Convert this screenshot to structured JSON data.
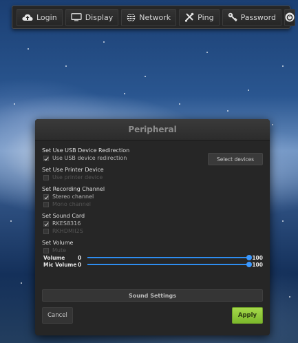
{
  "toolbar": {
    "items": [
      {
        "label": "Login",
        "icon": "cloud-upload-icon"
      },
      {
        "label": "Display",
        "icon": "monitor-icon"
      },
      {
        "label": "Network",
        "icon": "globe-icon"
      },
      {
        "label": "Ping",
        "icon": "tools-icon"
      },
      {
        "label": "Password",
        "icon": "key-icon"
      }
    ],
    "power_icon": "power-icon"
  },
  "dialog": {
    "title": "Peripheral",
    "usb": {
      "title": "Set Use USB Device Redirection",
      "option": "Use USB device redirection",
      "checked": true,
      "select_button": "Select devices"
    },
    "printer": {
      "title": "Set Use Printer Device",
      "option": "Use printer device",
      "checked": false
    },
    "recording": {
      "title": "Set Recording Channel",
      "options": [
        {
          "label": "Stereo channel",
          "checked": true
        },
        {
          "label": "Mono channel",
          "checked": false
        }
      ]
    },
    "sound_card": {
      "title": "Set Sound Card",
      "options": [
        {
          "label": "RKES8316",
          "checked": true
        },
        {
          "label": "RKHDMII2S",
          "checked": false
        }
      ]
    },
    "volume": {
      "title": "Set Volume",
      "mute_label": "Mute",
      "mute_checked": false,
      "volume_label": "Volume",
      "volume_min": "0",
      "volume_max": "100",
      "volume_value": 100,
      "mic_label": "Mic Volume",
      "mic_min": "0",
      "mic_max": "100",
      "mic_value": 100
    },
    "sound_settings_button": "Sound Settings",
    "cancel_button": "Cancel",
    "apply_button": "Apply"
  },
  "colors": {
    "accent_blue": "#2e8df0",
    "apply_green": "#8cc63f",
    "dialog_bg": "#262626"
  }
}
